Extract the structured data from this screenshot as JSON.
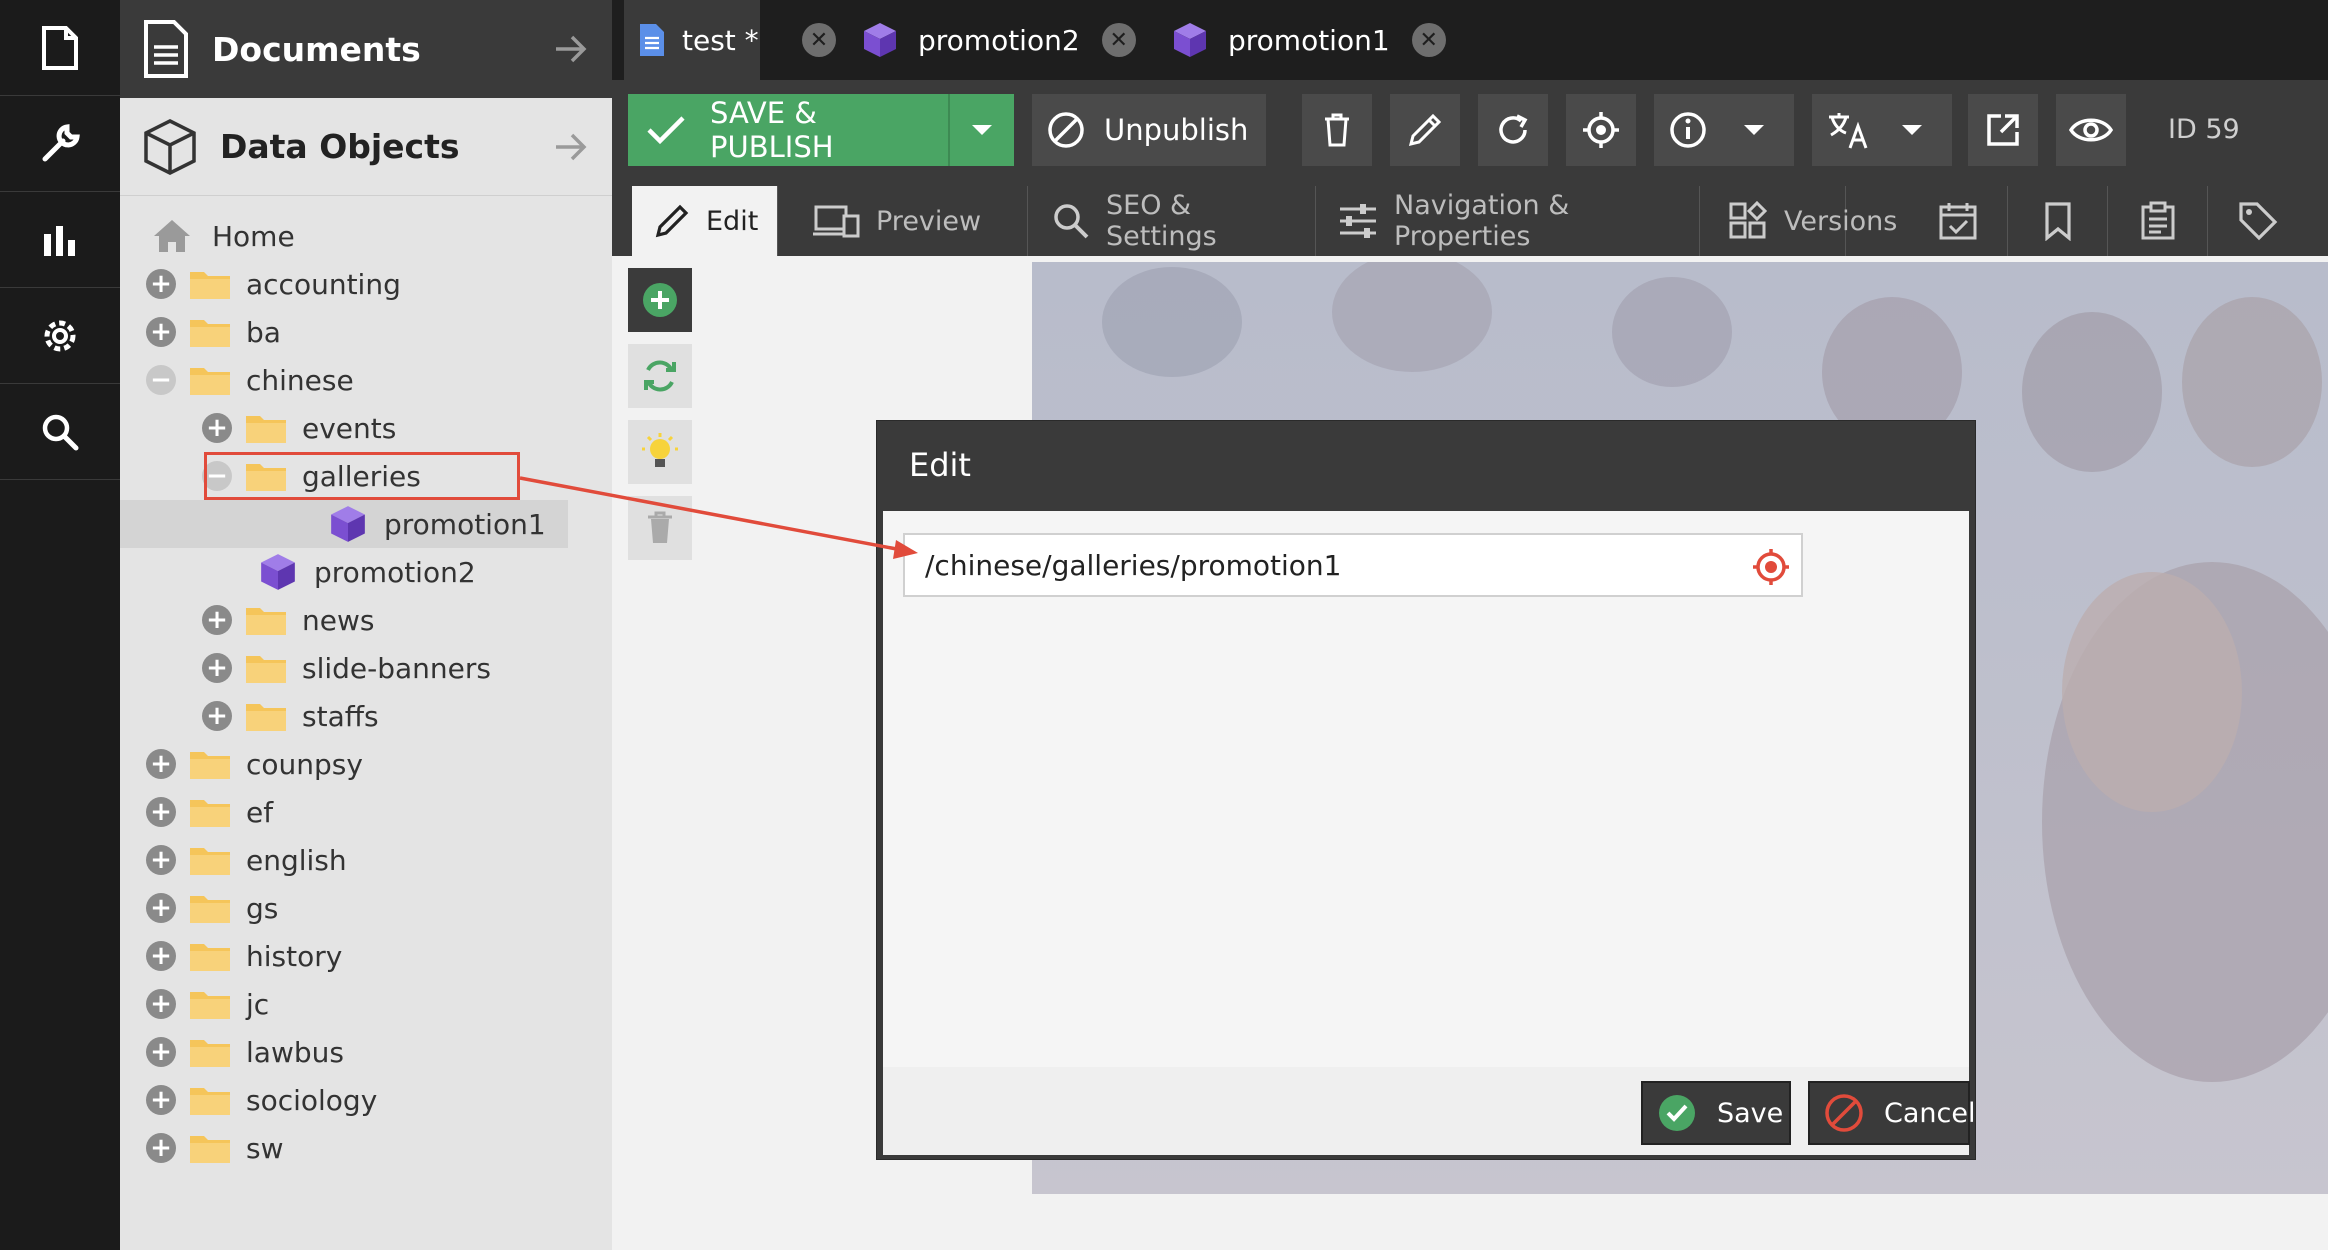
{
  "rail": [
    {
      "icon": "document-icon"
    },
    {
      "icon": "wrench-icon"
    },
    {
      "icon": "chart-icon"
    },
    {
      "icon": "gear-icon"
    },
    {
      "icon": "search-icon"
    }
  ],
  "panels": {
    "documents": "Documents",
    "data_objects": "Data Objects"
  },
  "tree": {
    "home": "Home",
    "rows": [
      {
        "label": "accounting",
        "toggle": "+",
        "kind": "folder"
      },
      {
        "label": "ba",
        "toggle": "+",
        "kind": "folder"
      },
      {
        "label": "chinese",
        "toggle": "−",
        "kind": "folder"
      },
      {
        "label": "events",
        "toggle": "+",
        "kind": "folder"
      },
      {
        "label": "galleries",
        "toggle": "−",
        "kind": "folder"
      },
      {
        "label": "promotion1",
        "toggle": "",
        "kind": "object"
      },
      {
        "label": "promotion2",
        "toggle": "",
        "kind": "object"
      },
      {
        "label": "news",
        "toggle": "+",
        "kind": "folder"
      },
      {
        "label": "slide-banners",
        "toggle": "+",
        "kind": "folder"
      },
      {
        "label": "staffs",
        "toggle": "+",
        "kind": "folder"
      },
      {
        "label": "counpsy",
        "toggle": "+",
        "kind": "folder"
      },
      {
        "label": "ef",
        "toggle": "+",
        "kind": "folder"
      },
      {
        "label": "english",
        "toggle": "+",
        "kind": "folder"
      },
      {
        "label": "gs",
        "toggle": "+",
        "kind": "folder"
      },
      {
        "label": "history",
        "toggle": "+",
        "kind": "folder"
      },
      {
        "label": "jc",
        "toggle": "+",
        "kind": "folder"
      },
      {
        "label": "lawbus",
        "toggle": "+",
        "kind": "folder"
      },
      {
        "label": "sociology",
        "toggle": "+",
        "kind": "folder"
      },
      {
        "label": "sw",
        "toggle": "+",
        "kind": "folder"
      }
    ]
  },
  "tabs": [
    {
      "label": "test *",
      "icon": "page-icon"
    },
    {
      "label": "promotion2",
      "icon": "cube-icon"
    },
    {
      "label": "promotion1",
      "icon": "cube-icon"
    }
  ],
  "toolbar": {
    "save_publish": "SAVE & PUBLISH",
    "unpublish": "Unpublish",
    "id_label": "ID 59"
  },
  "subtabs": {
    "edit": "Edit",
    "preview": "Preview",
    "seo": "SEO & Settings",
    "nav": "Navigation & Properties",
    "versions": "Versions"
  },
  "dialog": {
    "title": "Edit",
    "path_value": "/chinese/galleries/promotion1",
    "save": "Save",
    "cancel": "Cancel"
  },
  "colors": {
    "accent_green": "#4aa564",
    "annotation_red": "#e14b3b",
    "cube_purple": "#7b4fd1",
    "folder_yellow": "#f5c55a"
  }
}
